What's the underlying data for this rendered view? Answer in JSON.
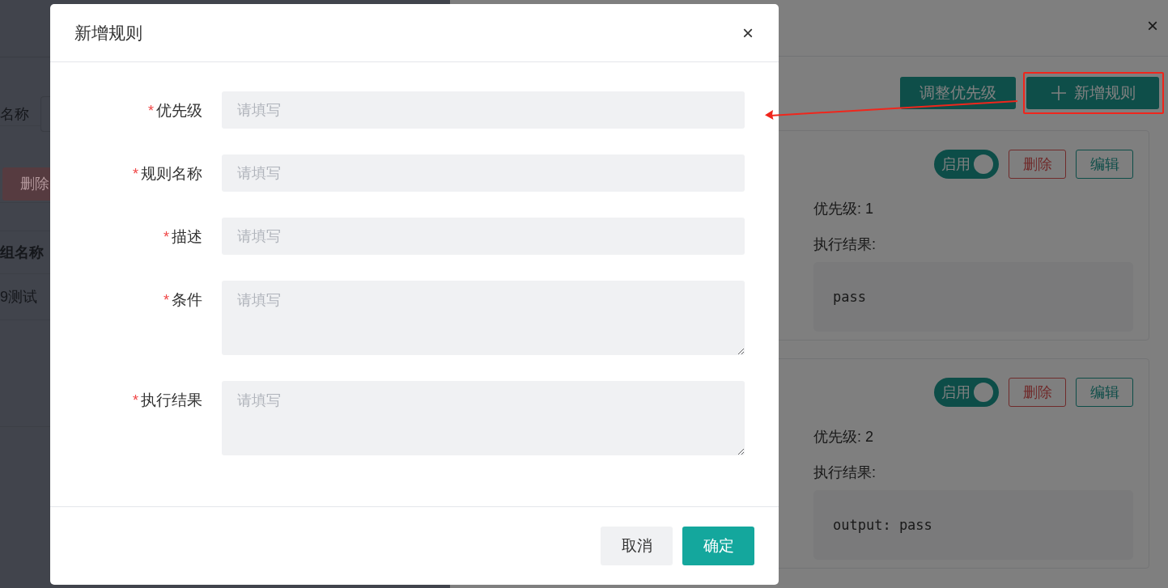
{
  "page": {
    "filter_label": "名称",
    "delete_button": "删除",
    "table_header": "组名称",
    "table_cell": "9测试"
  },
  "drawer": {
    "close": "×",
    "buttons": [
      {
        "label": "调整优先级",
        "kind": "plain"
      },
      {
        "label": "新增规则",
        "kind": "add"
      }
    ],
    "rules": [
      {
        "enabled": true,
        "switch_label": "启用",
        "delete": "删除",
        "edit": "编辑",
        "priority": "优先级: 1",
        "result_label": "执行结果:",
        "result": "pass"
      },
      {
        "enabled": true,
        "switch_label": "启用",
        "delete": "删除",
        "edit": "编辑",
        "priority": "优先级: 2",
        "result_label": "执行结果:",
        "result": "output: pass"
      }
    ]
  },
  "dialog": {
    "title": "新增规则",
    "close": "×",
    "fields": [
      {
        "label": "优先级",
        "required_mark": "*",
        "kind": "input",
        "placeholder": "请填写"
      },
      {
        "label": "规则名称",
        "required_mark": "*",
        "kind": "input",
        "placeholder": "请填写"
      },
      {
        "label": "描述",
        "required_mark": "*",
        "kind": "input",
        "placeholder": "请填写"
      },
      {
        "label": "条件",
        "required_mark": "*",
        "kind": "textarea",
        "placeholder": "请填写"
      },
      {
        "label": "执行结果",
        "required_mark": "*",
        "kind": "textarea",
        "placeholder": "请填写"
      }
    ],
    "buttons": [
      {
        "label": "取消",
        "kind": "secondary"
      },
      {
        "label": "确定",
        "kind": "primary"
      }
    ]
  }
}
